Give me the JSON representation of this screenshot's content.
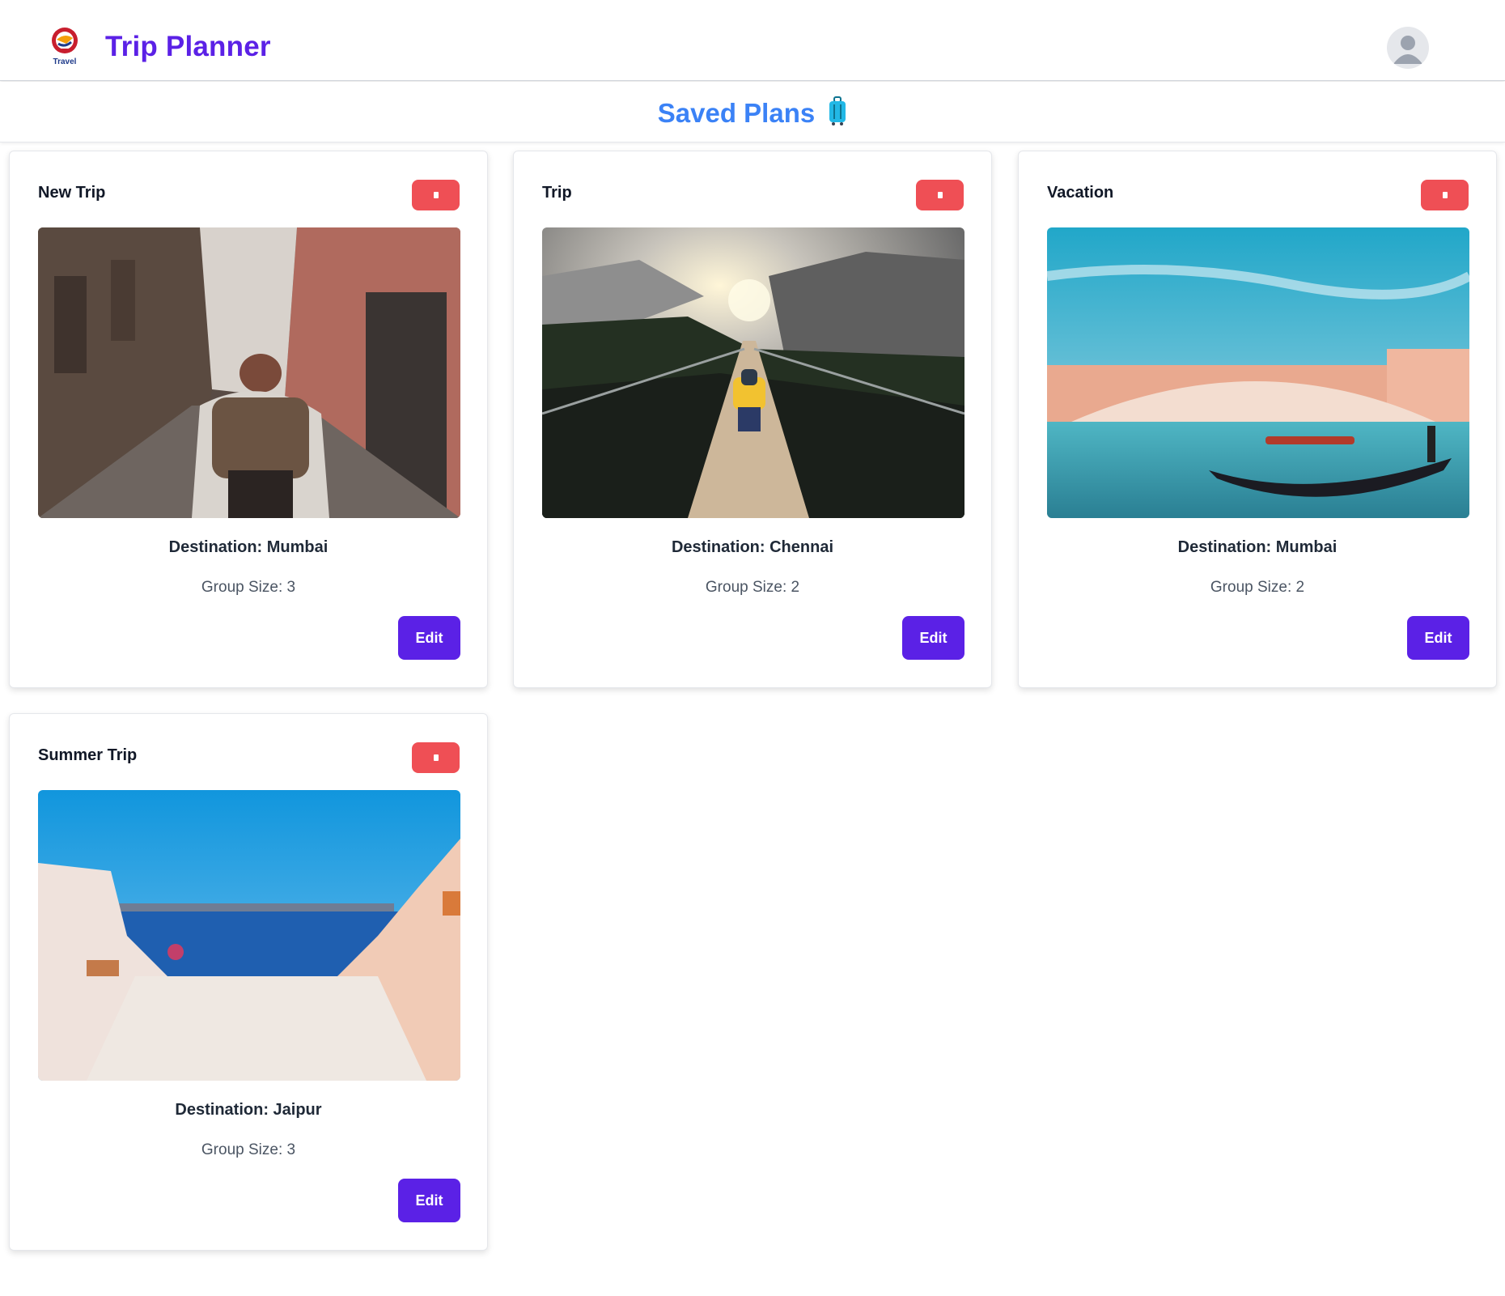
{
  "header": {
    "logo_text": "Travel",
    "title": "Trip Planner",
    "avatar_icon": "user-avatar-icon"
  },
  "section": {
    "title": "Saved Plans",
    "icon": "luggage-icon"
  },
  "colors": {
    "brand": "#5b21e6",
    "section_title": "#3b82f6",
    "delete": "#ef4f55"
  },
  "plans": [
    {
      "title": "New Trip",
      "destination": "Destination: Mumbai",
      "group_size": "Group Size: 3",
      "edit_label": "Edit",
      "delete_icon": "trash-icon"
    },
    {
      "title": "Trip",
      "destination": "Destination: Chennai",
      "group_size": "Group Size: 2",
      "edit_label": "Edit",
      "delete_icon": "trash-icon"
    },
    {
      "title": "Vacation",
      "destination": "Destination: Mumbai",
      "group_size": "Group Size: 2",
      "edit_label": "Edit",
      "delete_icon": "trash-icon"
    },
    {
      "title": "Summer Trip",
      "destination": "Destination: Jaipur",
      "group_size": "Group Size: 3",
      "edit_label": "Edit",
      "delete_icon": "trash-icon"
    }
  ]
}
